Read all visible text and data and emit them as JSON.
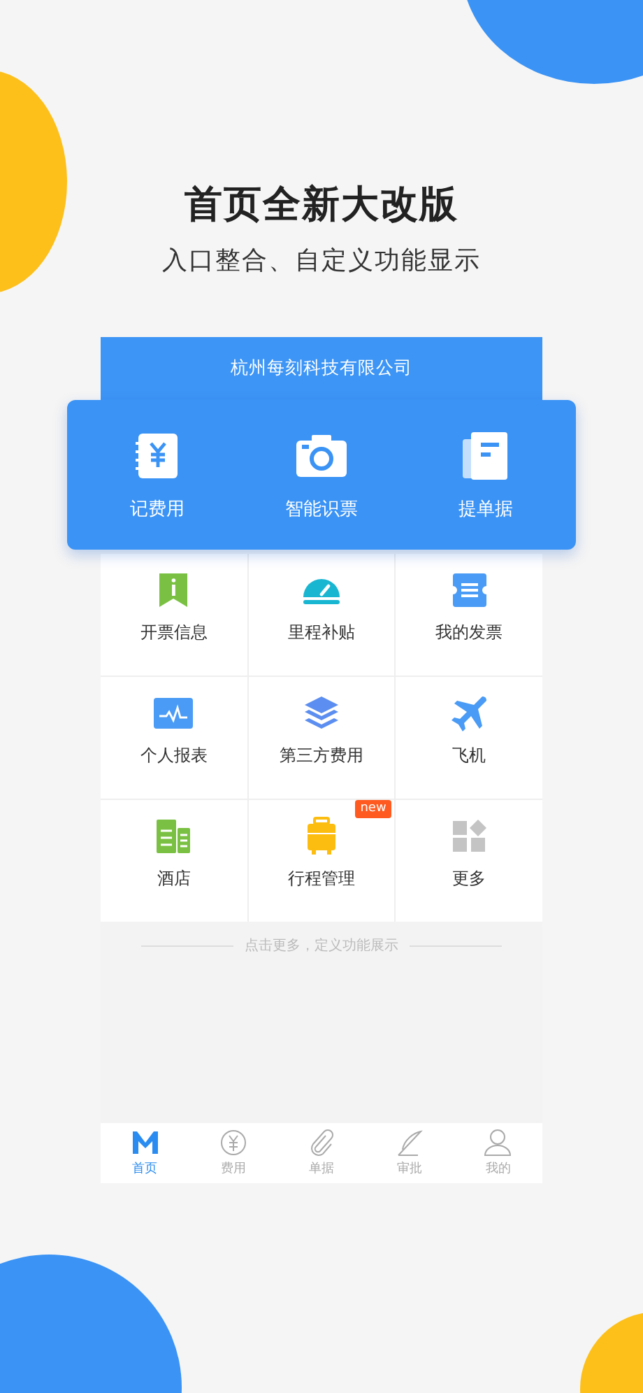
{
  "headline": "首页全新大改版",
  "subtitle": "入口整合、自定义功能显示",
  "company": "杭州每刻科技有限公司",
  "quick_actions": [
    {
      "label": "记费用"
    },
    {
      "label": "智能识票"
    },
    {
      "label": "提单据"
    }
  ],
  "features": [
    {
      "label": "开票信息"
    },
    {
      "label": "里程补贴"
    },
    {
      "label": "我的发票"
    },
    {
      "label": "个人报表"
    },
    {
      "label": "第三方费用"
    },
    {
      "label": "飞机"
    },
    {
      "label": "酒店"
    },
    {
      "label": "行程管理",
      "badge": "new"
    },
    {
      "label": "更多"
    }
  ],
  "hint": "点击更多，定义功能展示",
  "tab_bar": [
    {
      "label": "首页",
      "selected": true
    },
    {
      "label": "费用",
      "selected": false
    },
    {
      "label": "单据",
      "selected": false
    },
    {
      "label": "审批",
      "selected": false
    },
    {
      "label": "我的",
      "selected": false
    }
  ]
}
